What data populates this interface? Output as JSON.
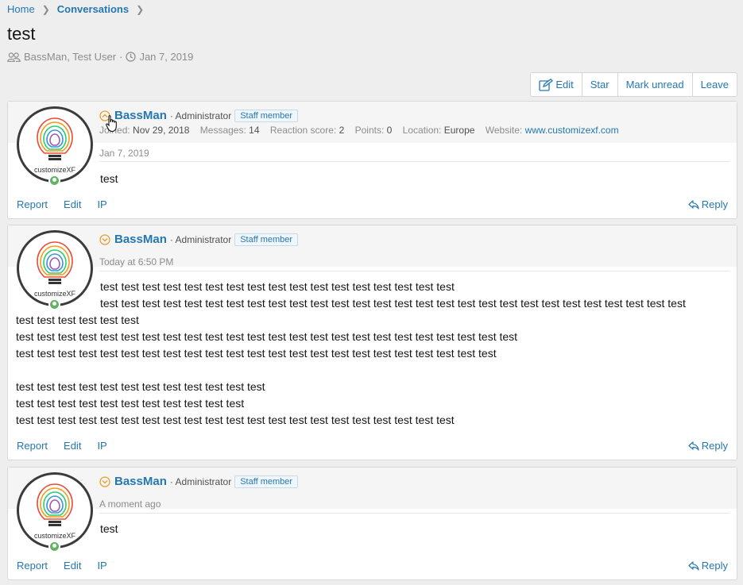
{
  "breadcrumb": {
    "home": "Home",
    "current": "Conversations"
  },
  "title": "test",
  "meta": {
    "participants": "BassMan, Test User",
    "date": "Jan 7, 2019"
  },
  "buttons": {
    "edit": "Edit",
    "star": "Star",
    "mark_unread": "Mark unread",
    "leave": "Leave"
  },
  "avatar_text": "customizeXF",
  "colors": {
    "link": "#2577b1",
    "online": "#63b265",
    "toggle": "#e8a035"
  },
  "messages": [
    {
      "username": "BassMan",
      "role": "Administrator",
      "badge": "Staff member",
      "stats": {
        "joined_label": "Joined:",
        "joined": "Nov 29, 2018",
        "messages_label": "Messages:",
        "messages": "14",
        "reaction_label": "Reaction score:",
        "reaction": "2",
        "points_label": "Points:",
        "points": "0",
        "location_label": "Location:",
        "location": "Europe",
        "website_label": "Website:",
        "website": "www.customizexf.com"
      },
      "date": "Jan 7, 2019",
      "body": "test",
      "actions": {
        "report": "Report",
        "edit": "Edit",
        "ip": "IP",
        "reply": "Reply"
      }
    },
    {
      "username": "BassMan",
      "role": "Administrator",
      "badge": "Staff member",
      "date": "Today at 6:50 PM",
      "body_lines": [
        "test test test test test test test test test test test test test test test test test",
        "test test test test test test test test test test test test test test test test test test test test test test test test test test test test",
        "test test test test test test",
        "test test test test test test test test test test test test test test test test test test test test test test test test",
        "test test test test test test test test test test test test test test test test test test test test test test test",
        "",
        "test test test test test test test test test test test test",
        "test test test test test test test test test test test",
        "test test test test test test test test test test test test test test test test test test test test test"
      ],
      "actions": {
        "report": "Report",
        "edit": "Edit",
        "ip": "IP",
        "reply": "Reply"
      }
    },
    {
      "username": "BassMan",
      "role": "Administrator",
      "badge": "Staff member",
      "date": "A moment ago",
      "body": "test",
      "actions": {
        "report": "Report",
        "edit": "Edit",
        "ip": "IP",
        "reply": "Reply"
      }
    }
  ]
}
